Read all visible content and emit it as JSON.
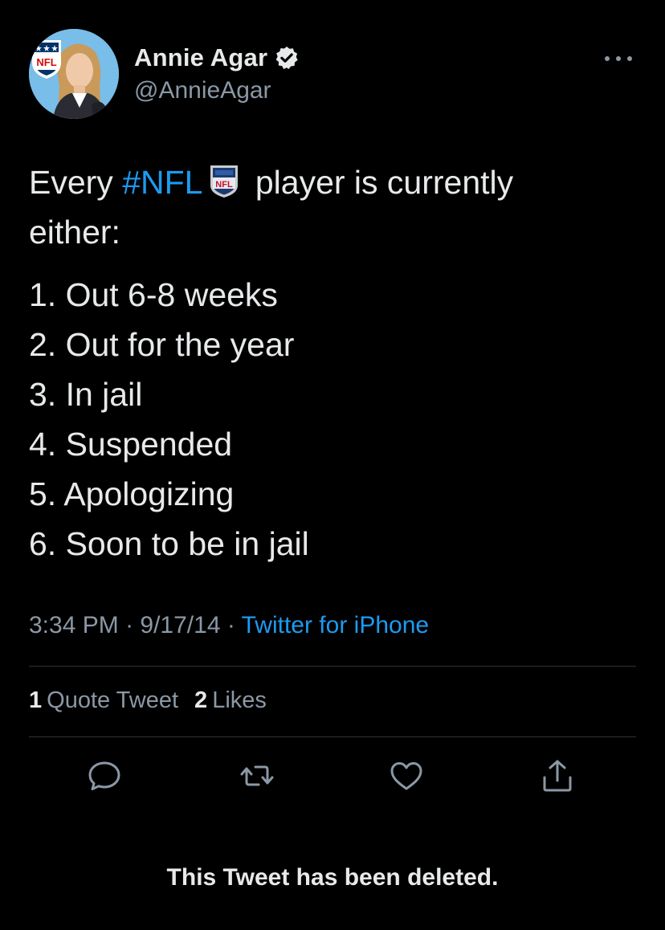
{
  "author": {
    "display_name": "Annie Agar",
    "handle": "@AnnieAgar",
    "verified": true,
    "avatar_badge_text": "NFL"
  },
  "tweet": {
    "text_before": "Every ",
    "hashtag": "#NFL",
    "emoji_icon": "nfl-shield-icon",
    "text_after": " player is currently",
    "text_line2": "either:",
    "list": [
      "1. Out 6-8 weeks",
      "2. Out for the year",
      "3. In jail",
      "4. Suspended",
      "5. Apologizing",
      "6. Soon to be in jail"
    ]
  },
  "meta": {
    "time": "3:34 PM",
    "separator": " · ",
    "date": "9/17/14",
    "source": "Twitter for iPhone"
  },
  "stats": {
    "quote_count": "1",
    "quote_label": "Quote Tweet",
    "like_count": "2",
    "like_label": "Likes"
  },
  "actions": [
    "reply-icon",
    "retweet-icon",
    "like-icon",
    "share-icon"
  ],
  "notice": "This Tweet has been deleted.",
  "colors": {
    "background": "#000000",
    "text": "#e7e9ea",
    "secondary": "#8b98a5",
    "link": "#1d9bf0",
    "divider": "#2f3336"
  }
}
